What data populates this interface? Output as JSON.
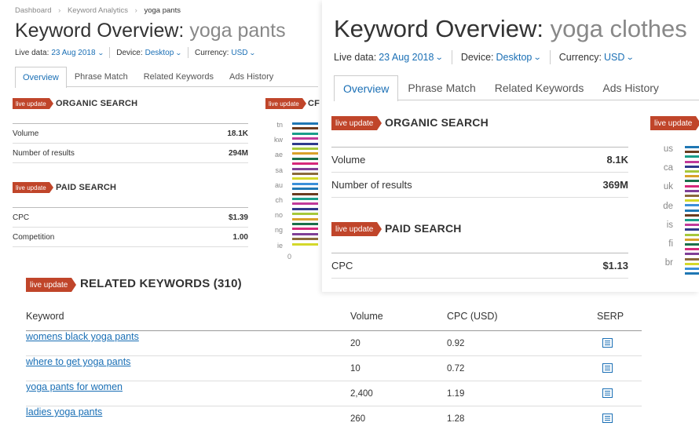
{
  "left_panel": {
    "breadcrumb": [
      "Dashboard",
      "Keyword Analytics",
      "yoga pants"
    ],
    "title": "Keyword Overview:",
    "keyword": "yoga pants",
    "meta": {
      "live_data_label": "Live data:",
      "live_data_value": "23 Aug 2018",
      "device_label": "Device:",
      "device_value": "Desktop",
      "currency_label": "Currency:",
      "currency_value": "USD"
    },
    "tabs": [
      "Overview",
      "Phrase Match",
      "Related Keywords",
      "Ads History"
    ],
    "active_tab": "Overview",
    "organic": {
      "badge": "live update",
      "heading": "ORGANIC SEARCH",
      "rows": [
        {
          "label": "Volume",
          "value": "18.1K"
        },
        {
          "label": "Number of results",
          "value": "294M"
        }
      ]
    },
    "paid": {
      "badge": "live update",
      "heading": "PAID SEARCH",
      "rows": [
        {
          "label": "CPC",
          "value": "$1.39"
        },
        {
          "label": "Competition",
          "value": "1.00"
        }
      ]
    },
    "distribution": {
      "badge": "live update",
      "heading_fragment": "CF",
      "countries": [
        "tn",
        "kw",
        "ae",
        "sa",
        "au",
        "ch",
        "no",
        "ng",
        "ie"
      ],
      "axis_zero": "0"
    },
    "related": {
      "badge": "live update",
      "heading": "RELATED KEYWORDS (310)",
      "columns": [
        "Keyword",
        "Volume",
        "CPC (USD)",
        "SERP"
      ],
      "rows": [
        {
          "keyword": "womens black yoga pants",
          "volume": "20",
          "cpc": "0.92"
        },
        {
          "keyword": "where to get yoga pants",
          "volume": "10",
          "cpc": "0.72"
        },
        {
          "keyword": "yoga pants for women",
          "volume": "2,400",
          "cpc": "1.19"
        },
        {
          "keyword": "ladies yoga pants",
          "volume": "260",
          "cpc": "1.28"
        }
      ]
    }
  },
  "right_panel": {
    "title": "Keyword Overview:",
    "keyword": "yoga clothes",
    "meta": {
      "live_data_label": "Live data:",
      "live_data_value": "23 Aug 2018",
      "device_label": "Device:",
      "device_value": "Desktop",
      "currency_label": "Currency:",
      "currency_value": "USD"
    },
    "tabs": [
      "Overview",
      "Phrase Match",
      "Related Keywords",
      "Ads History"
    ],
    "active_tab": "Overview",
    "organic": {
      "badge": "live update",
      "heading": "ORGANIC SEARCH",
      "rows": [
        {
          "label": "Volume",
          "value": "8.1K"
        },
        {
          "label": "Number of results",
          "value": "369M"
        }
      ]
    },
    "paid": {
      "badge": "live update",
      "heading": "PAID SEARCH",
      "rows": [
        {
          "label": "CPC",
          "value": "$1.13"
        }
      ]
    },
    "distribution": {
      "badge": "live update",
      "countries": [
        "us",
        "ca",
        "uk",
        "de",
        "is",
        "fi",
        "br"
      ]
    }
  },
  "colors": {
    "accent": "#1a6fb5",
    "badge": "#c0452a",
    "bar_palette": [
      "#1f77b4",
      "#6b3b1e",
      "#1a9e8a",
      "#c03a9a",
      "#2e3a8c",
      "#a6c83a",
      "#d9a12a",
      "#1a6f4a",
      "#d6287a",
      "#7f3f98",
      "#8a6a3a",
      "#d4d82a",
      "#3a8fd9"
    ]
  },
  "icons": [
    "chevron-right-icon",
    "chevron-down-icon",
    "serp-list-icon"
  ]
}
